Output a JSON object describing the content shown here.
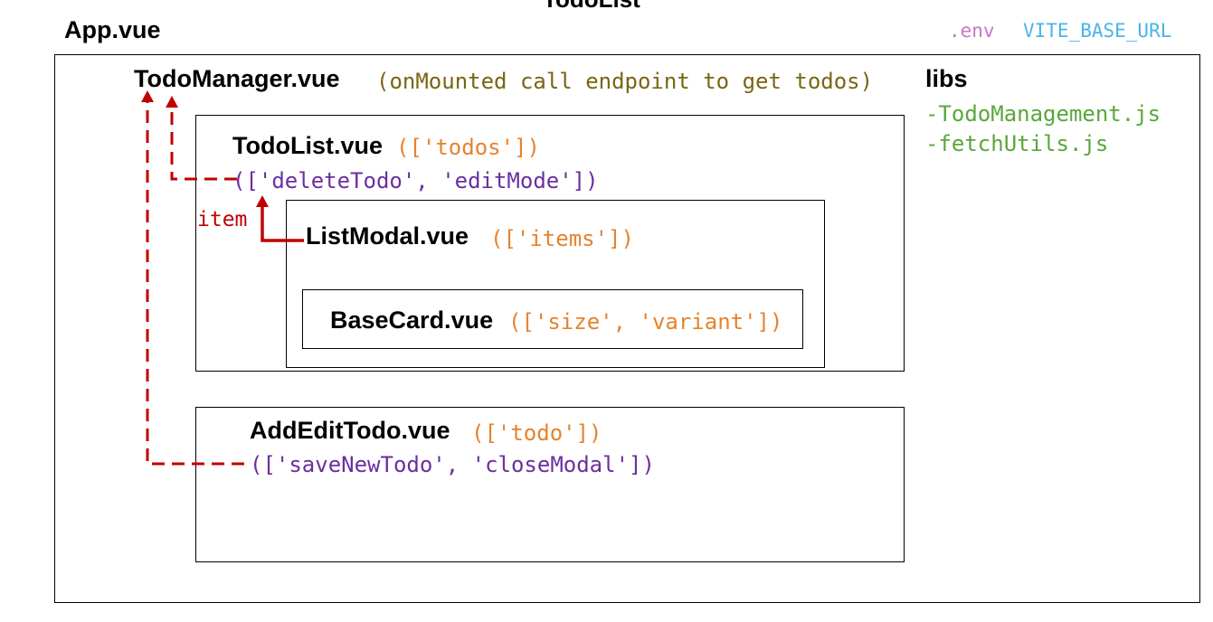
{
  "title_partial": "TodoList",
  "app": {
    "label": "App.vue"
  },
  "env": {
    "file": ".env",
    "var": "VITE_BASE_URL"
  },
  "libs": {
    "heading": "libs",
    "files": [
      "-TodoManagement.js",
      "-fetchUtils.js"
    ]
  },
  "todo_manager": {
    "name": "TodoManager.vue",
    "note": "(onMounted call endpoint to get todos)"
  },
  "todo_list": {
    "name": "TodoList.vue",
    "props": "(['todos'])",
    "emits": "(['deleteTodo', 'editMode'])"
  },
  "list_modal": {
    "name": "ListModal.vue",
    "props": "(['items'])",
    "emit_label": "item"
  },
  "base_card": {
    "name": "BaseCard.vue",
    "props": "(['size', 'variant'])"
  },
  "add_edit_todo": {
    "name": "AddEditTodo.vue",
    "props": "(['todo'])",
    "emits": "(['saveNewTodo', 'closeModal'])"
  },
  "colors": {
    "props": "#e5832e",
    "emits": "#6b2fa0",
    "note": "#7a6513",
    "libs": "#5aa63c",
    "env": "#c47ac5",
    "env_var": "#4ab4e8",
    "emit_arrow": "#c00000"
  }
}
